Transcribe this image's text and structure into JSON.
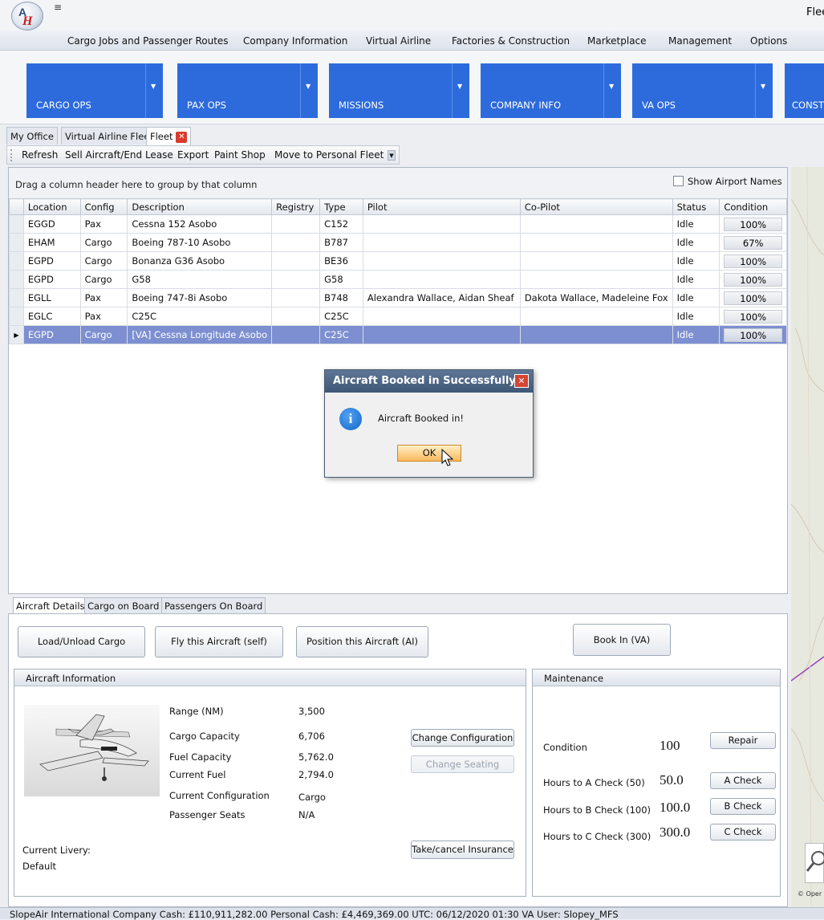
{
  "window": {
    "title_partial": "Flee"
  },
  "menu": [
    "Cargo Jobs and Passenger Routes",
    "Company Information",
    "Virtual Airline",
    "Factories & Construction",
    "Marketplace",
    "Management",
    "Options"
  ],
  "ribbon": [
    "CARGO OPS",
    "PAX OPS",
    "MISSIONS",
    "COMPANY INFO",
    "VA OPS",
    "CONST"
  ],
  "doc_tabs": {
    "my_office": "My Office",
    "va_fleet": "Virtual Airline Fleet",
    "fleet": "Fleet"
  },
  "toolbar": {
    "refresh": "Refresh",
    "sell": "Sell Aircraft/End Lease",
    "export": "Export",
    "paint": "Paint Shop",
    "move": "Move to Personal Fleet"
  },
  "grid": {
    "group_hint": "Drag a column header here to group by that column",
    "show_airport_names": "Show Airport Names",
    "columns": [
      "Location",
      "Config",
      "Description",
      "Registry",
      "Type",
      "Pilot",
      "Co-Pilot",
      "Status",
      "Condition"
    ],
    "rows": [
      {
        "location": "EGGD",
        "config": "Pax",
        "description": "Cessna 152 Asobo",
        "registry": "",
        "type": "C152",
        "pilot": "",
        "copilot": "",
        "status": "Idle",
        "condition": "100%"
      },
      {
        "location": "EHAM",
        "config": "Cargo",
        "description": "Boeing 787-10 Asobo",
        "registry": "",
        "type": "B787",
        "pilot": "",
        "copilot": "",
        "status": "Idle",
        "condition": "67%"
      },
      {
        "location": "EGPD",
        "config": "Cargo",
        "description": "Bonanza G36 Asobo",
        "registry": "",
        "type": "BE36",
        "pilot": "",
        "copilot": "",
        "status": "Idle",
        "condition": "100%"
      },
      {
        "location": "EGPD",
        "config": "Cargo",
        "description": "G58",
        "registry": "",
        "type": "G58",
        "pilot": "",
        "copilot": "",
        "status": "Idle",
        "condition": "100%"
      },
      {
        "location": "EGLL",
        "config": "Pax",
        "description": "Boeing 747-8i Asobo",
        "registry": "",
        "type": "B748",
        "pilot": "Alexandra Wallace, Aidan Sheaf",
        "copilot": "Dakota Wallace, Madeleine Fox",
        "status": "Idle",
        "condition": "100%"
      },
      {
        "location": "EGLC",
        "config": "Pax",
        "description": "C25C",
        "registry": "",
        "type": "C25C",
        "pilot": "",
        "copilot": "",
        "status": "Idle",
        "condition": "100%"
      },
      {
        "location": "EGPD",
        "config": "Cargo",
        "description": "[VA] Cessna Longitude Asobo",
        "registry": "",
        "type": "C25C",
        "pilot": "",
        "copilot": "",
        "status": "Idle",
        "condition": "100%"
      }
    ]
  },
  "dialog": {
    "title": "Aircraft Booked in Successfully!",
    "message": "Aircraft Booked in!",
    "ok": "OK"
  },
  "bottom_tabs": [
    "Aircraft Details",
    "Cargo on Board",
    "Passengers On Board"
  ],
  "actions": {
    "load_unload": "Load/Unload Cargo",
    "fly_self": "Fly this Aircraft (self)",
    "position_ai": "Position this Aircraft (AI)",
    "book_in": "Book In (VA)"
  },
  "aircraft_info": {
    "header": "Aircraft Information",
    "range_label": "Range (NM)",
    "range": "3,500",
    "cargo_label": "Cargo Capacity",
    "cargo": "6,706",
    "fuel_cap_label": "Fuel Capacity",
    "fuel_cap": "5,762.0",
    "fuel_cur_label": "Current Fuel",
    "fuel_cur": "2,794.0",
    "config_label": "Current Configuration",
    "config": "Cargo",
    "seats_label": "Passenger Seats",
    "seats": "N/A",
    "livery_label": "Current Livery:",
    "livery": "Default",
    "change_config": "Change Configuration",
    "change_seating": "Change Seating",
    "insurance": "Take/cancel Insurance"
  },
  "maintenance": {
    "header": "Maintenance",
    "condition_label": "Condition",
    "condition": "100",
    "repair": "Repair",
    "a_label": "Hours to A Check (50)",
    "a_value": "50.0",
    "a_btn": "A Check",
    "b_label": "Hours to B Check (100)",
    "b_value": "100.0",
    "b_btn": "B Check",
    "c_label": "Hours to C Check (300)",
    "c_value": "300.0",
    "c_btn": "C Check"
  },
  "map": {
    "attribution": "© Oper"
  },
  "status": {
    "text": "SlopeAir International   Company Cash: £110,911,282.00   Personal Cash: £4,469,369.00   UTC: 06/12/2020  01:30   VA User: Slopey_MFS"
  },
  "colors": {
    "ribbon_blue": "#2d6bdc",
    "selection": "#7d8fd0",
    "dialog_title": "#4a6282"
  }
}
